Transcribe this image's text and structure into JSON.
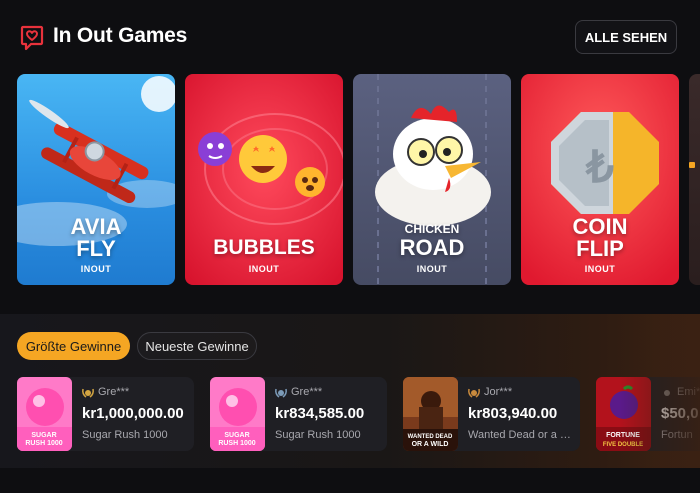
{
  "header": {
    "title": "In Out Games",
    "see_all_label": "ALLE SEHEN",
    "icon": "heart-chat-icon",
    "accent_color": "#e8323c"
  },
  "games": [
    {
      "name_line1": "AVIA",
      "name_line2": "FLY",
      "provider": "INOUT",
      "theme_color": "#2c8fe0"
    },
    {
      "name_line1": "",
      "name_line2": "BUBBLES",
      "provider": "INOUT",
      "theme_color": "#e8223c"
    },
    {
      "name_line1": "CHICKEN",
      "name_line2": "ROAD",
      "provider": "INOUT",
      "theme_color": "#565c74"
    },
    {
      "name_line1": "COIN",
      "name_line2": "FLIP",
      "provider": "INOUT",
      "theme_color": "#ea2b3b"
    }
  ],
  "wins": {
    "tabs": [
      {
        "label": "Größte Gewinne",
        "active": true
      },
      {
        "label": "Neueste Gewinne",
        "active": false
      }
    ],
    "items": [
      {
        "user": "Gre***",
        "amount": "kr1,000,000.00",
        "game": "Sugar Rush 1000",
        "thumb_text": "SUGAR RUSH 1000",
        "badge_color": "#d4a642"
      },
      {
        "user": "Gre***",
        "amount": "kr834,585.00",
        "game": "Sugar Rush 1000",
        "thumb_text": "SUGAR RUSH 1000",
        "badge_color": "#7c9bb8"
      },
      {
        "user": "Jor***",
        "amount": "kr803,940.00",
        "game": "Wanted Dead or a W...",
        "thumb_text": "WANTED DEAD OR A WILD",
        "badge_color": "#c98a3d"
      },
      {
        "user": "Emi***",
        "amount": "$50,0",
        "game": "Fortun",
        "thumb_text": "FORTUNE FIVE DOUBLE",
        "badge_color": "#8a8a8a"
      }
    ]
  }
}
